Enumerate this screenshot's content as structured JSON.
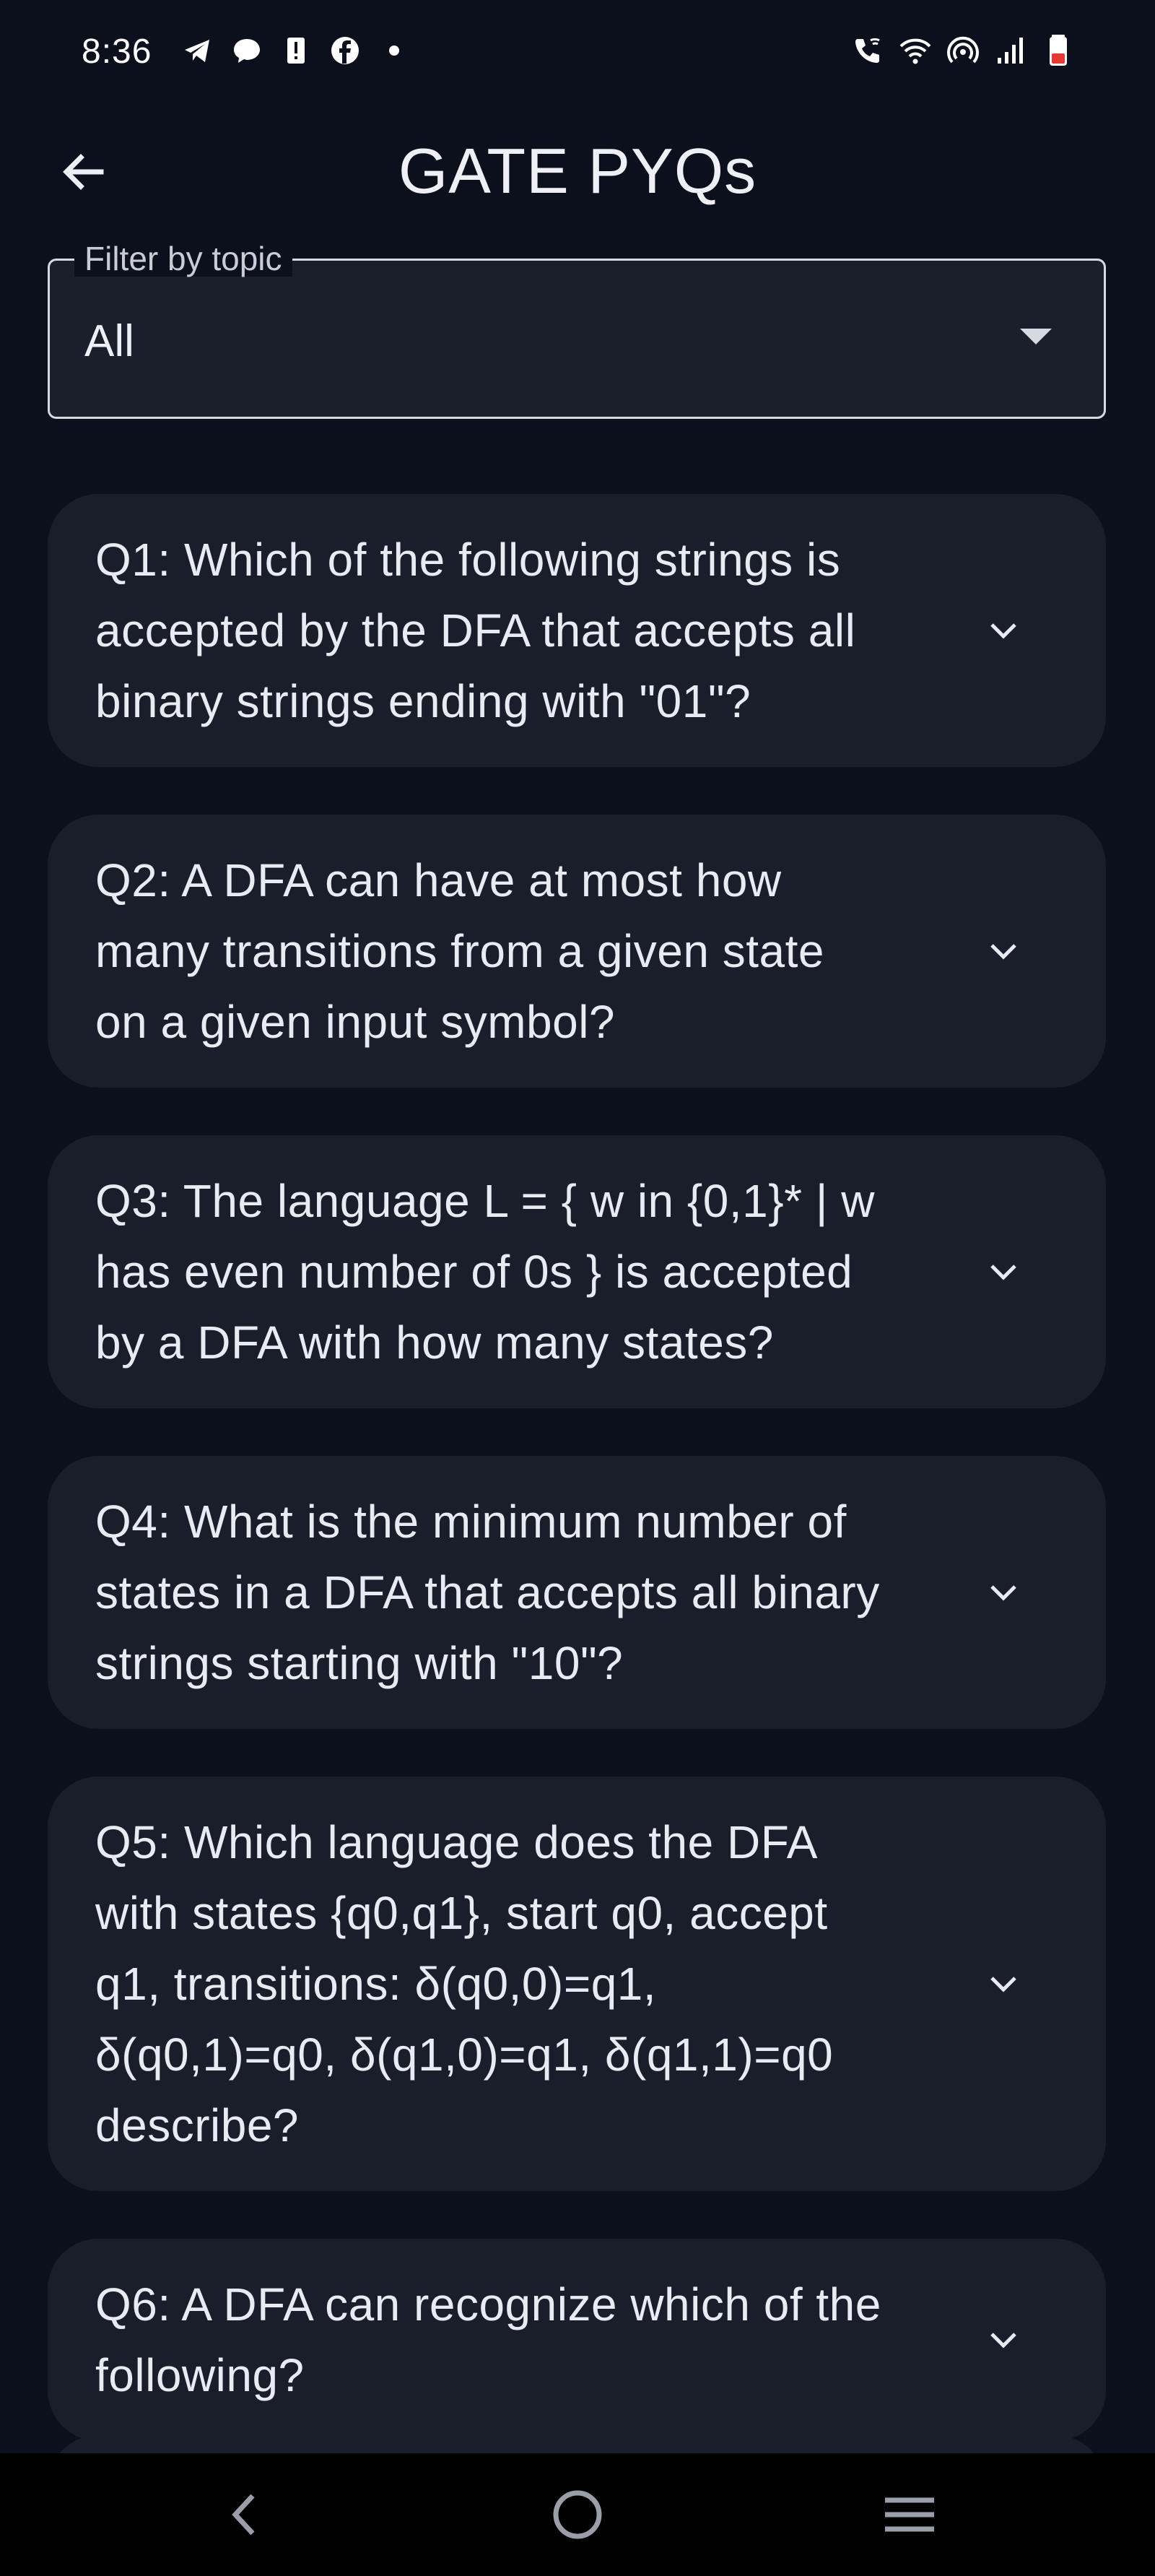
{
  "status_bar": {
    "time": "8:36",
    "left_icons": [
      "telegram-icon",
      "chat-bubble-icon",
      "alert-icon",
      "facebook-icon",
      "dot-icon"
    ],
    "right_icons": [
      "wifi-call-icon",
      "wifi-icon",
      "hotspot-icon",
      "signal-icon",
      "battery-low-icon"
    ]
  },
  "app_bar": {
    "title": "GATE PYQs",
    "back_icon": "arrow-left-icon"
  },
  "filter": {
    "label": "Filter by topic",
    "value": "All"
  },
  "questions": [
    {
      "text": "Q1: Which of the following strings is accepted by the DFA that accepts all binary strings ending with \"01\"?"
    },
    {
      "text": "Q2: A DFA can have at most how many transitions from a given state on a given input symbol?"
    },
    {
      "text": "Q3: The language L = { w in {0,1}* | w has even number of 0s } is accepted by a DFA with how many states?"
    },
    {
      "text": "Q4: What is the minimum number of states in a DFA that accepts all binary strings starting with \"10\"?"
    },
    {
      "text": "Q5: Which language does the DFA with states {q0,q1}, start q0, accept q1, transitions: δ(q0,0)=q1, δ(q0,1)=q0, δ(q1,0)=q1, δ(q1,1)=q0 describe?"
    },
    {
      "text": "Q6: A DFA can recognize which of the following?"
    }
  ],
  "nav_bar": {
    "icons": [
      "nav-back-icon",
      "nav-home-icon",
      "nav-menu-icon"
    ]
  },
  "colors": {
    "background": "#0b101c",
    "card": "#191e2a",
    "text": "#e8ebf2",
    "battery_low": "#e53935"
  }
}
